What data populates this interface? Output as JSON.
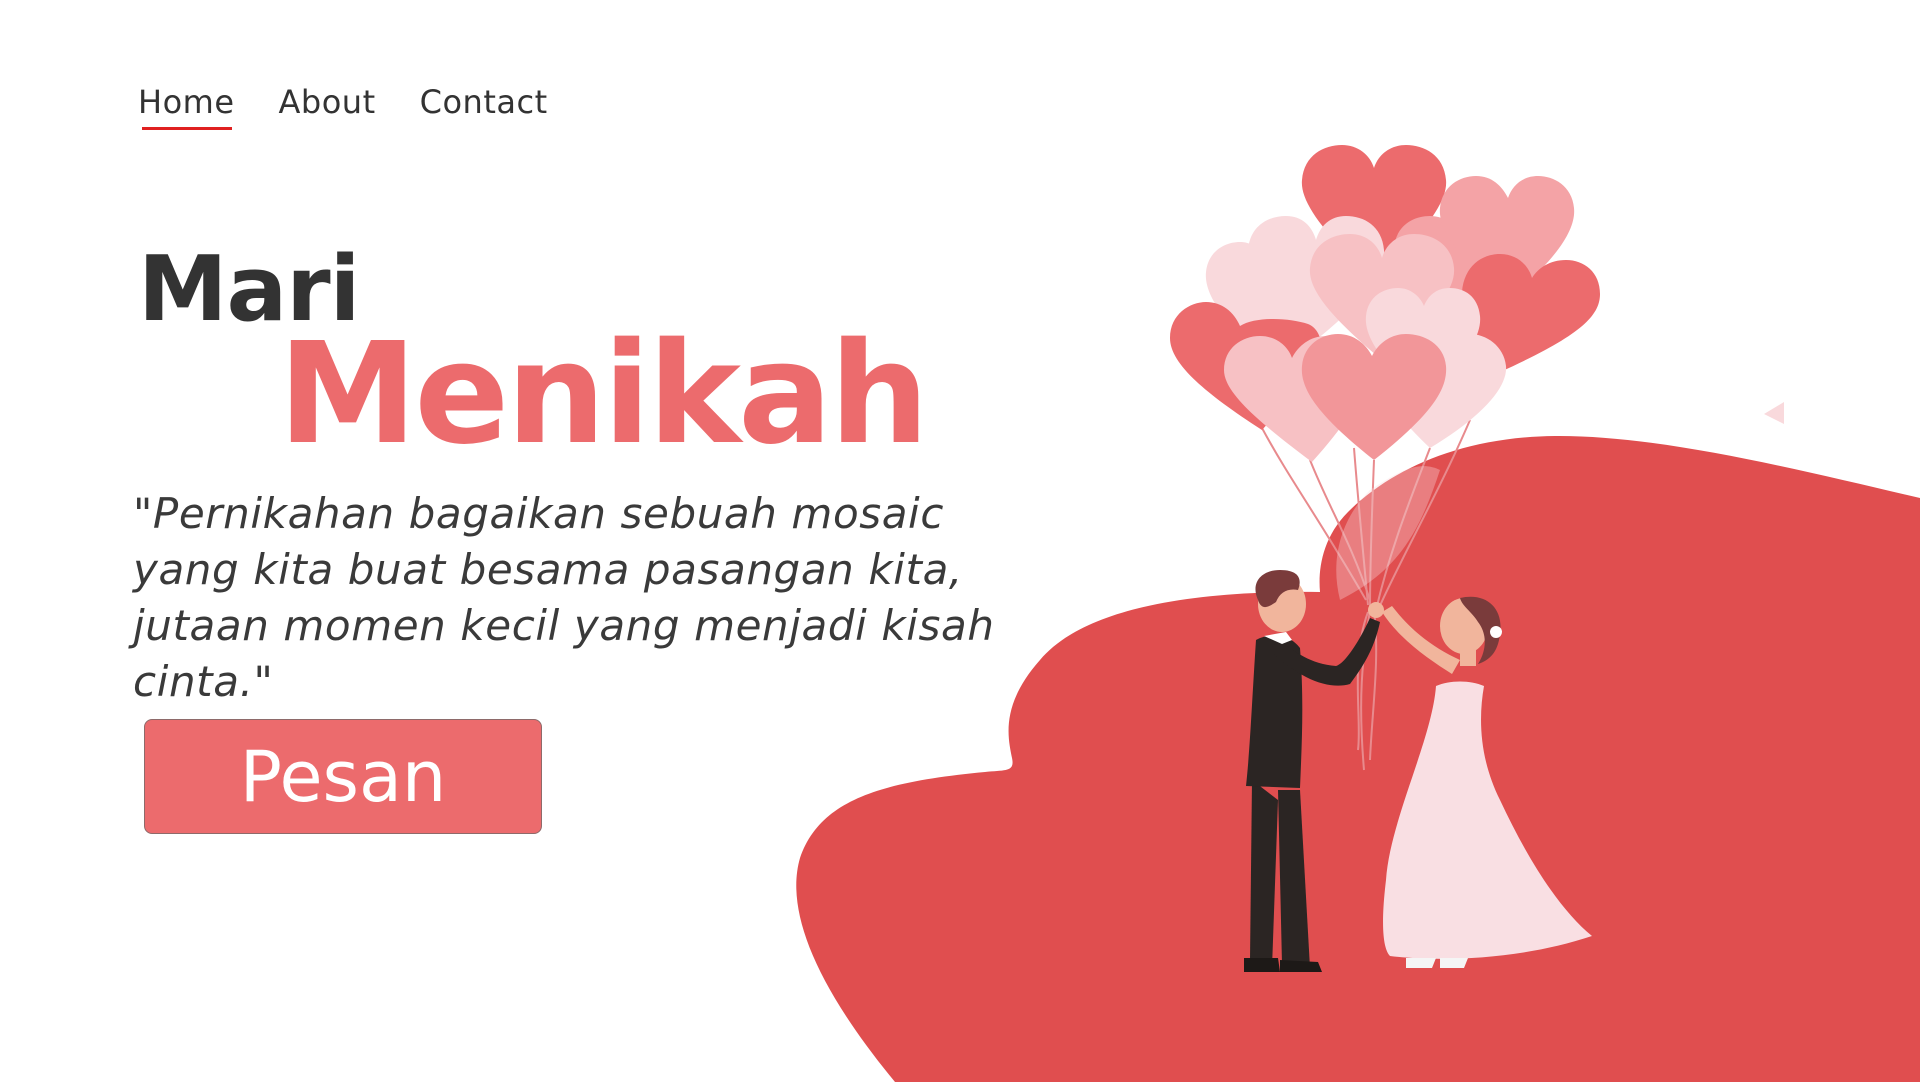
{
  "nav": {
    "items": [
      {
        "label": "Home",
        "active": true
      },
      {
        "label": "About",
        "active": false
      },
      {
        "label": "Contact",
        "active": false
      }
    ]
  },
  "hero": {
    "title_line1": "Mari",
    "title_line2": "Menikah",
    "quote": "\"Pernikahan bagaikan sebuah mosaic yang kita buat besama pasangan kita, jutaan momen kecil yang menjadi kisah cinta.\"",
    "button_label": "Pesan"
  },
  "colors": {
    "accent": "#ec6b6d",
    "blob": "#e04e4f",
    "text_dark": "#333333",
    "nav_underline": "#e02020",
    "balloon_light": "#f9d9dc",
    "balloon_mid": "#f4a3a6",
    "balloon_dark": "#ec6b6d"
  },
  "illustration": {
    "icons": [
      "heart-balloon",
      "groom",
      "bride"
    ]
  }
}
